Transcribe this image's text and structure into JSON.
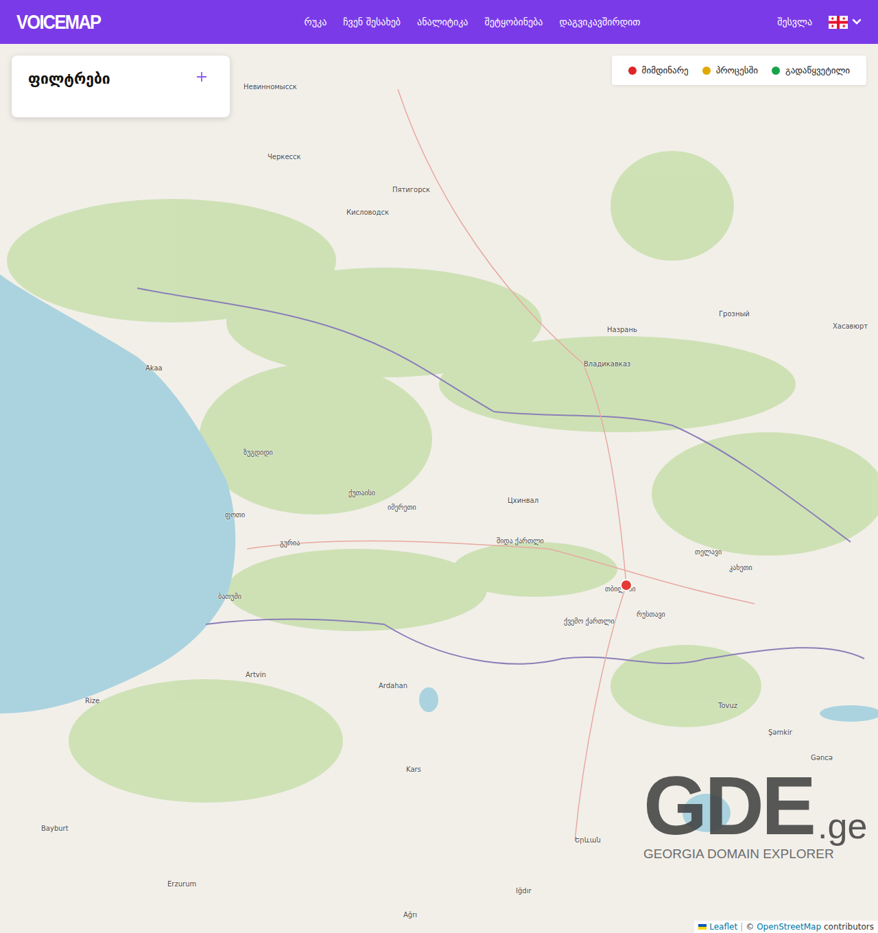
{
  "header": {
    "logo": "VOICEMAP",
    "nav": [
      {
        "label": "რუკა",
        "selected": false
      },
      {
        "label": "ჩვენ შესახებ",
        "selected": false
      },
      {
        "label": "ანალიტიკა",
        "selected": false
      },
      {
        "label": "შეტყობინება",
        "selected": false
      },
      {
        "label": "დაგვიკავშირდით",
        "selected": false
      }
    ],
    "login": "შესვლა"
  },
  "filters": {
    "title": "ფილტრები"
  },
  "legend": [
    {
      "label": "მიმდინარე",
      "color": "#dc2626"
    },
    {
      "label": "პროცესში",
      "color": "#e0a800"
    },
    {
      "label": "გადაწყვეტილი",
      "color": "#16a34a"
    }
  ],
  "map": {
    "labels": [
      {
        "name": "Невинномысск"
      },
      {
        "name": "Черкесск"
      },
      {
        "name": "Пятигорск"
      },
      {
        "name": "Кисловодск"
      },
      {
        "name": "Грозный"
      },
      {
        "name": "Назрань"
      },
      {
        "name": "Хасавюрт"
      },
      {
        "name": "Владикавказ"
      },
      {
        "name": "Цхинвал"
      },
      {
        "name": "ქუთაისი"
      },
      {
        "name": "იმერეთი"
      },
      {
        "name": "ზუგდიდი"
      },
      {
        "name": "ფოთი"
      },
      {
        "name": "გურია"
      },
      {
        "name": "ბათუმი"
      },
      {
        "name": "თბილისი"
      },
      {
        "name": "რუსთავი"
      },
      {
        "name": "თელავი"
      },
      {
        "name": "კახეთი"
      },
      {
        "name": "შიდა ქართლი"
      },
      {
        "name": "ქვემო ქართლი"
      },
      {
        "name": "Artvin"
      },
      {
        "name": "Rize"
      },
      {
        "name": "Ardahan"
      },
      {
        "name": "Kars"
      },
      {
        "name": "Erzurum"
      },
      {
        "name": "Bayburt"
      },
      {
        "name": "Tovuz"
      },
      {
        "name": "Şəmkir"
      },
      {
        "name": "Gəncə"
      },
      {
        "name": "Երևան"
      },
      {
        "name": "Iğdır"
      },
      {
        "name": "Ağrı"
      },
      {
        "name": "Akaa"
      }
    ],
    "pins": [
      {
        "color": "#e53935"
      }
    ]
  },
  "watermark": {
    "mark": "GDE",
    "tld": ".ge",
    "tagline": "GEORGIA DOMAIN EXPLORER"
  },
  "attribution": {
    "leaflet": "Leaflet",
    "sep": "|",
    "copy": "©",
    "osm": "OpenStreetMap",
    "contributors": "contributors"
  }
}
